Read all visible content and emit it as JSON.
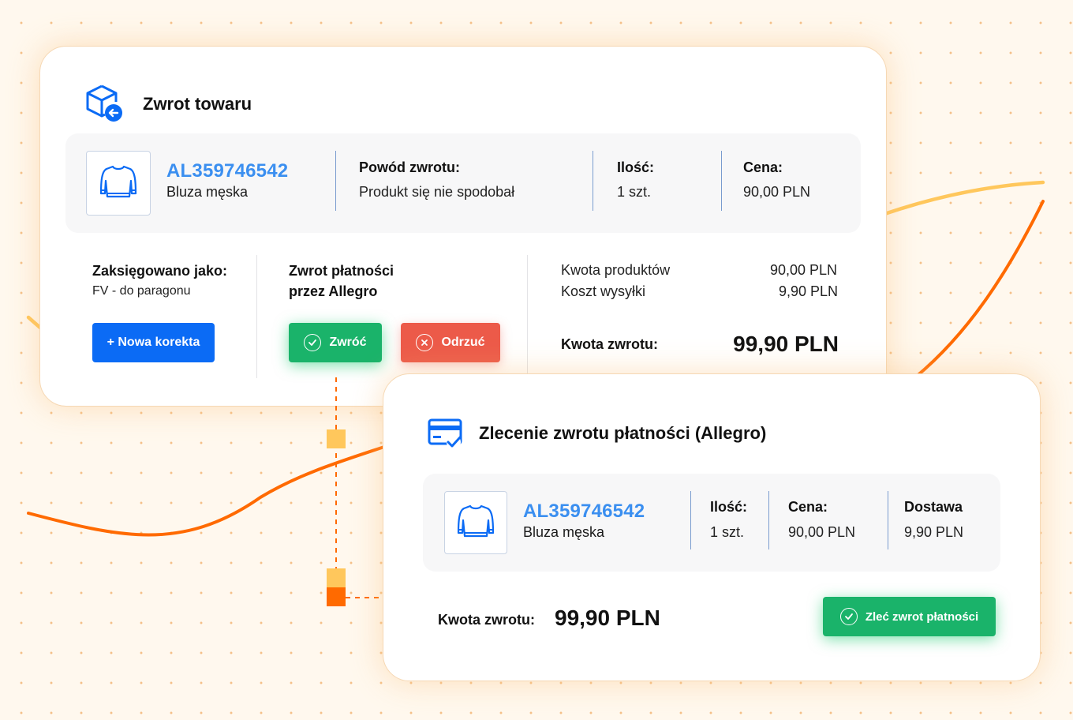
{
  "colors": {
    "accent_blue": "#0b6bf5",
    "code_blue": "#3b8ff0",
    "green": "#1ab36a",
    "red": "#ec5a49",
    "orange": "#ff6a00",
    "yellow": "#ffc75c"
  },
  "return_card": {
    "icon": "box-return-icon",
    "title": "Zwrot towaru",
    "product": {
      "icon": "sweatshirt-icon",
      "code": "AL359746542",
      "name": "Bluza męska"
    },
    "reason_label": "Powód zwrotu:",
    "reason_value": "Produkt się nie spodobał",
    "qty_label": "Ilość:",
    "qty_value": "1 szt.",
    "price_label": "Cena:",
    "price_value": "90,00 PLN",
    "booked_label": "Zaksięgowano jako:",
    "booked_value": "FV - do paragonu",
    "new_correction_button": "+ Nowa korekta",
    "refund_label_line1": "Zwrot płatności",
    "refund_label_line2": "przez Allegro",
    "return_button": "Zwróć",
    "reject_button": "Odrzuć",
    "products_amount_label": "Kwota produktów",
    "products_amount_value": "90,00 PLN",
    "shipping_cost_label": "Koszt wysyłki",
    "shipping_cost_value": "9,90 PLN",
    "refund_amount_label": "Kwota zwrotu:",
    "refund_amount_value": "99,90 PLN"
  },
  "payment_card": {
    "icon": "card-check-icon",
    "title": "Zlecenie zwrotu płatności (Allegro)",
    "product": {
      "icon": "sweatshirt-icon",
      "code": "AL359746542",
      "name": "Bluza męska"
    },
    "qty_label": "Ilość:",
    "qty_value": "1 szt.",
    "price_label": "Cena:",
    "price_value": "90,00 PLN",
    "delivery_label": "Dostawa",
    "delivery_value": "9,90 PLN",
    "refund_amount_label": "Kwota zwrotu:",
    "refund_amount_value": "99,90 PLN",
    "order_refund_button": "Zleć zwrot płatności"
  }
}
